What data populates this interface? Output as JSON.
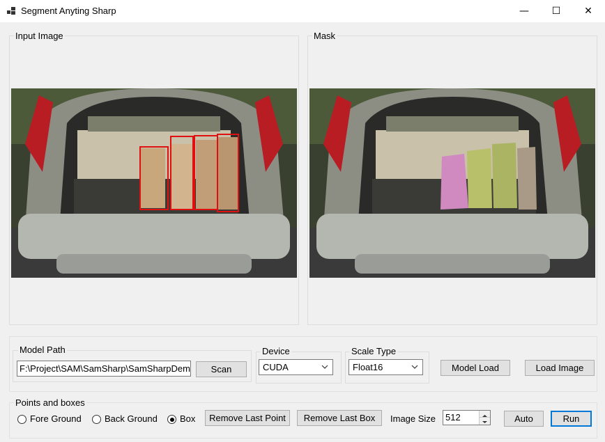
{
  "window": {
    "title": "Segment Anyting Sharp",
    "minimize": "—",
    "maximize": "☐",
    "close": "✕"
  },
  "panels": {
    "input_label": "Input Image",
    "mask_label": "Mask"
  },
  "model": {
    "group_label": "Model Path",
    "path_value": "F:\\Project\\SAM\\SamSharp\\SamSharpDemo",
    "scan_button": "Scan",
    "device_label": "Device",
    "device_value": "CUDA",
    "scale_label": "Scale Type",
    "scale_value": "Float16",
    "model_load_button": "Model Load",
    "load_image_button": "Load Image"
  },
  "points": {
    "group_label": "Points and boxes",
    "fore_ground": "Fore Ground",
    "back_ground": "Back Ground",
    "box": "Box",
    "selected": "Box",
    "remove_last_point": "Remove Last Point",
    "remove_last_box": "Remove Last Box",
    "image_size_label": "Image Size",
    "image_size_value": "512",
    "auto_button": "Auto",
    "run_button": "Run"
  },
  "colors": {
    "box_outline": "#e01010",
    "mask_pink": "#d08ac0",
    "mask_olive": "#b8c06a",
    "accent": "#0078d7"
  }
}
